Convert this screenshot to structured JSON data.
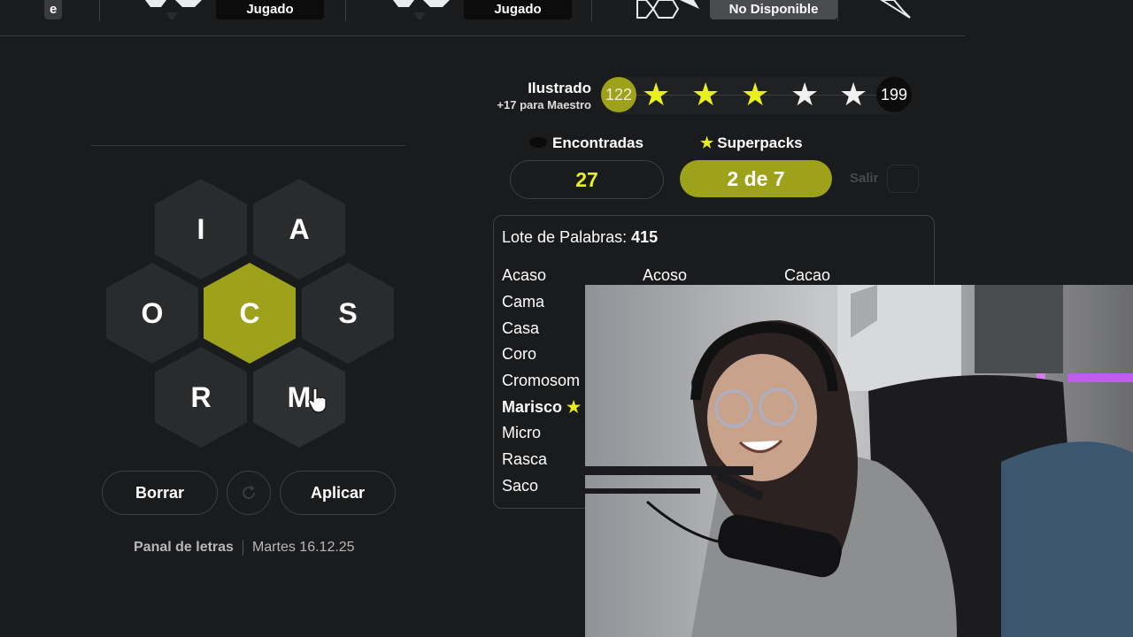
{
  "top_strip": {
    "partial_chip": "e",
    "chips": [
      "Jugado",
      "Jugado",
      "No Disponible"
    ]
  },
  "hive": {
    "letters": {
      "top_left": "I",
      "top_right": "A",
      "mid_left": "O",
      "center": "C",
      "mid_right": "S",
      "bottom_left": "R",
      "bottom_right": "M"
    }
  },
  "controls": {
    "delete": "Borrar",
    "shuffle_icon": "refresh-icon",
    "apply": "Aplicar"
  },
  "footer": {
    "game": "Panal de letras",
    "date": "Martes 16.12.25"
  },
  "rank": {
    "title": "Ilustrado",
    "subtitle": "+17 para Maestro",
    "current_score": "122",
    "max_score": "199",
    "stars_filled": 3,
    "stars_total": 5
  },
  "stats": {
    "found_label": "Encontradas",
    "found_value": "27",
    "superpacks_label": "Superpacks",
    "superpacks_value": "2 de 7",
    "exit_label": "Salir"
  },
  "word_list": {
    "label": "Lote de Palabras:",
    "count": "415",
    "col1": [
      "Acaso",
      "Cama",
      "Casa",
      "Coro",
      "Cromosom",
      "Marisco",
      "Micro",
      "Rasca",
      "Saco"
    ],
    "col2": [
      "Acoso"
    ],
    "col3": [
      "Cacao"
    ],
    "highlighted_word": "Marisco"
  },
  "colors": {
    "accent": "#9ea11a",
    "star": "#e8ef1e",
    "background": "#1a1b1d"
  }
}
